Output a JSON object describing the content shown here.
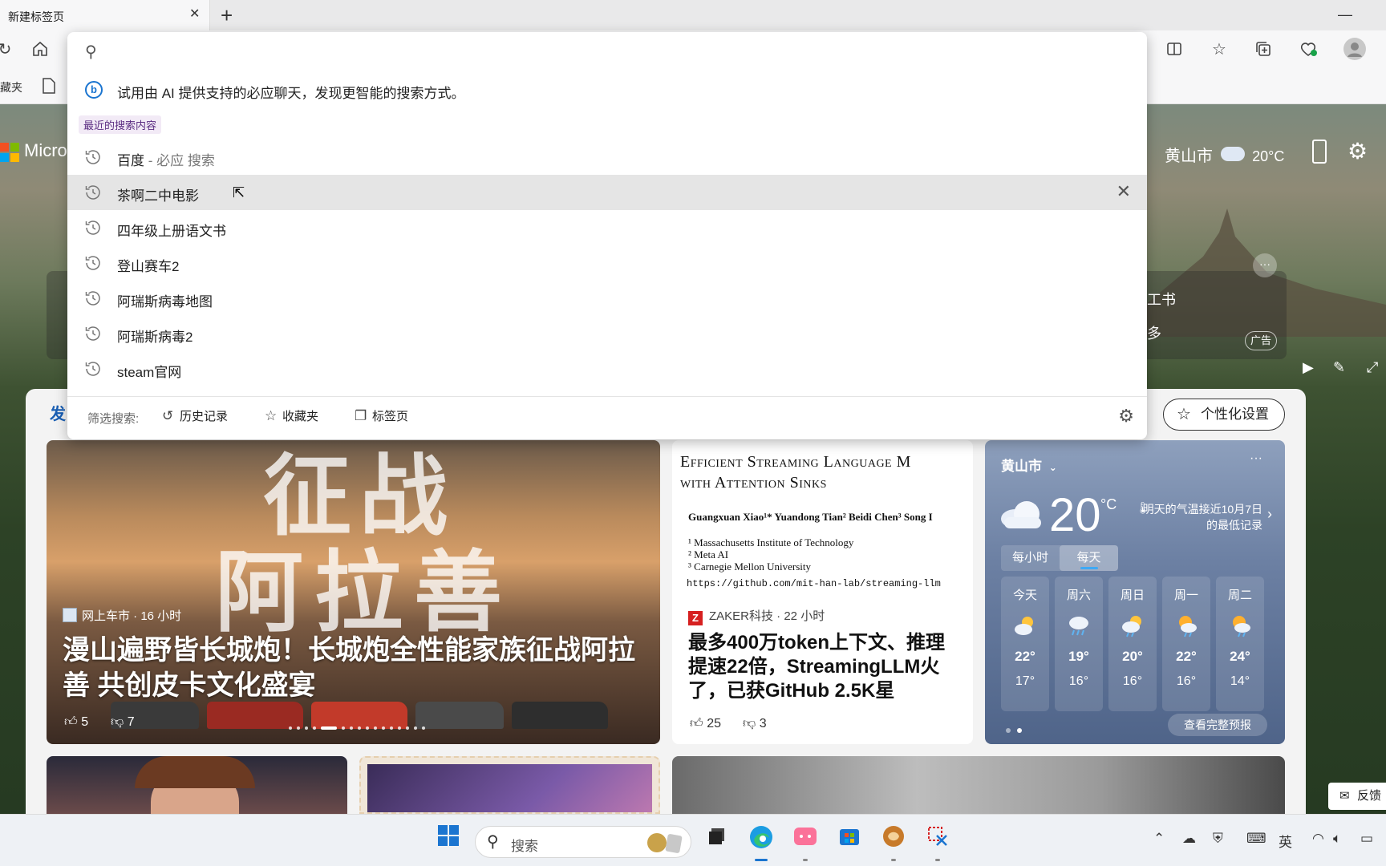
{
  "browser": {
    "tab_title": "新建标签页",
    "tab_close": "✕",
    "new_tab": "+",
    "minimize": "—",
    "favbar_partial": "藏夹"
  },
  "background_page": {
    "brand_partial": "Micro",
    "weather_city": "黄山市",
    "weather_temp": "20°C",
    "ad_partial_1": "工书",
    "ad_partial_2": "多",
    "ad_tag": "广告",
    "ad_more": "···",
    "fa_partial": "发",
    "personalize_label": "个性化设置",
    "feedback_label": "反馈"
  },
  "hero": {
    "calligraphy_line1": "征战",
    "calligraphy_line2": "阿拉善",
    "source": "网上车市 · 16 小时",
    "title": "漫山遍野皆长城炮！长城炮全性能家族征战阿拉善 共创皮卡文化盛宴",
    "likes": "5",
    "dislikes": "7"
  },
  "paper_card": {
    "paper_title_1": "Efficient Streaming Language M",
    "paper_title_2": "with Attention Sinks",
    "paper_authors": "Guangxuan Xiao¹*   Yuandong Tian²   Beidi Chen³   Song I",
    "paper_aff_1": "¹ Massachusetts Institute of Technology",
    "paper_aff_2": "² Meta AI",
    "paper_aff_3": "³ Carnegie Mellon University",
    "paper_url": "https://github.com/mit-han-lab/streaming-llm",
    "source_icon": "Z",
    "source": "ZAKER科技 · 22 小时",
    "title": "最多400万token上下文、推理提速22倍，StreamingLLM火了，已获GitHub 2.5K星",
    "likes": "25",
    "dislikes": "3"
  },
  "weather_card": {
    "city": "黄山市",
    "more": "···",
    "temp": "20",
    "unit": "°C",
    "note": "明天的气温接近10月7日的最低记录",
    "tab_hourly": "每小时",
    "tab_daily": "每天",
    "days": [
      {
        "name": "今天",
        "high": "22°",
        "low": "17°",
        "icon": "partly-cloudy-icon"
      },
      {
        "name": "周六",
        "high": "19°",
        "low": "16°",
        "icon": "rain-icon"
      },
      {
        "name": "周日",
        "high": "20°",
        "low": "16°",
        "icon": "sun-rain-icon"
      },
      {
        "name": "周一",
        "high": "22°",
        "low": "16°",
        "icon": "sun-rain-icon"
      },
      {
        "name": "周二",
        "high": "24°",
        "low": "14°",
        "icon": "sun-rain-icon"
      }
    ],
    "full_forecast": "查看完整预报"
  },
  "dropdown": {
    "ai_prompt": "试用由 AI 提供支持的必应聊天，发现更智能的搜索方式。",
    "recent_label": "最近的搜索内容",
    "items": [
      {
        "text": "百度",
        "suffix": " - 必应 搜索"
      },
      {
        "text": "茶啊二中电影",
        "suffix": ""
      },
      {
        "text": "四年级上册语文书",
        "suffix": ""
      },
      {
        "text": "登山赛车2",
        "suffix": ""
      },
      {
        "text": "阿瑞斯病毒地图",
        "suffix": ""
      },
      {
        "text": "阿瑞斯病毒2",
        "suffix": ""
      },
      {
        "text": "steam官网",
        "suffix": ""
      }
    ],
    "filter_label": "筛选搜索:",
    "filter_history": "历史记录",
    "filter_favorites": "收藏夹",
    "filter_tabs": "标签页"
  },
  "taskbar": {
    "search_placeholder": "搜索",
    "ime": "英"
  },
  "colors": {
    "accent": "#1b75d0",
    "recent_label_bg": "#f2eaf6",
    "recent_label_fg": "#5b2d82",
    "hover_row": "#e5e5e5"
  }
}
